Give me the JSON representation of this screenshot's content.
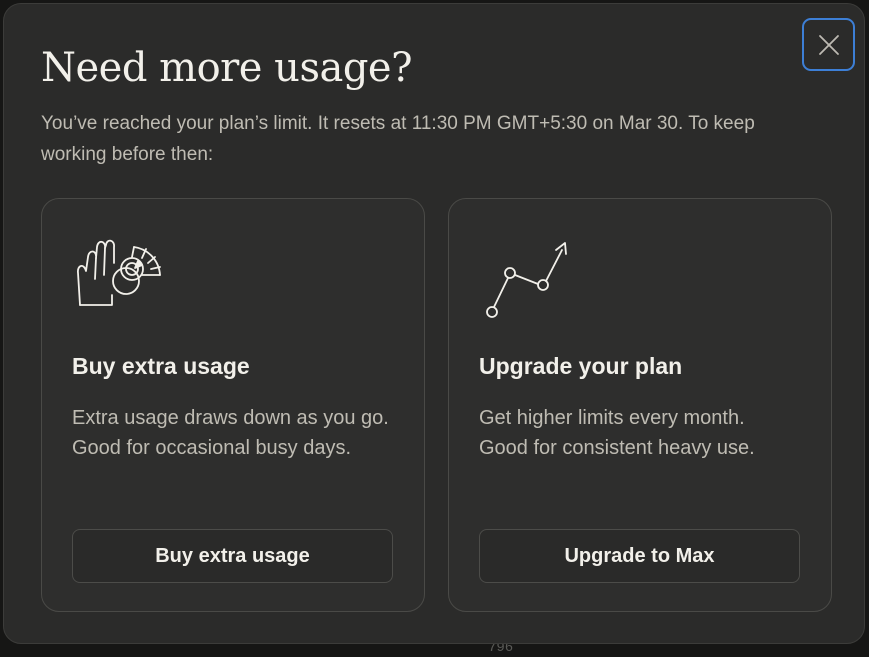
{
  "dialog": {
    "title": "Need more usage?",
    "subtitle": "You’ve reached your plan’s limit. It resets at 11:30 PM GMT+5:30 on Mar 30. To keep working before then:",
    "close_icon": "close-icon"
  },
  "cards": [
    {
      "icon": "hand-gauge-icon",
      "title": "Buy extra usage",
      "description": "Extra usage draws down as you go. Good for occasional busy days.",
      "button_label": "Buy extra usage"
    },
    {
      "icon": "trend-up-icon",
      "title": "Upgrade your plan",
      "description": "Get higher limits every month. Good for consistent heavy use.",
      "button_label": "Upgrade to Max"
    }
  ],
  "background": {
    "line_number_hint": "796"
  },
  "colors": {
    "dialog_bg": "#2b2b2a",
    "card_bg": "#2e2e2d",
    "text_primary": "#f2f0ea",
    "text_secondary": "#bfbcb3",
    "focus_ring": "#3d7fd6"
  }
}
